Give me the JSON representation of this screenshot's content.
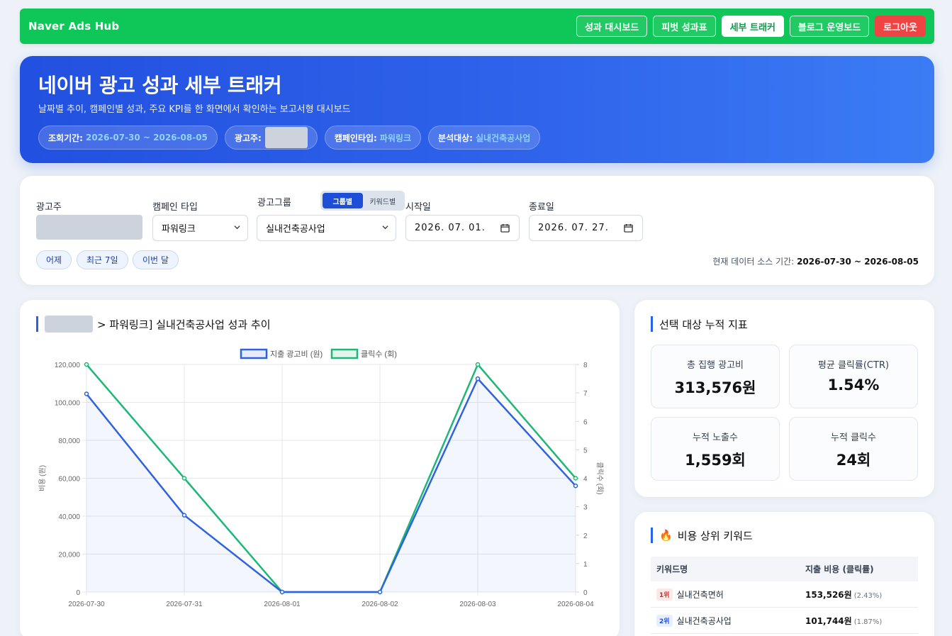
{
  "nav": {
    "brand": "Naver Ads Hub",
    "items": [
      {
        "label": "성과 대시보드"
      },
      {
        "label": "피벗 성과표"
      },
      {
        "label": "세부 트래커"
      },
      {
        "label": "블로그 운영보드"
      },
      {
        "label": "로그아웃"
      }
    ],
    "active_index": 2
  },
  "hero": {
    "title": "네이버 광고 성과 세부 트래커",
    "subtitle": "날짜별 추이, 캠페인별 성과, 주요 KPI를 한 화면에서 확인하는 보고서형 대시보드",
    "chips": {
      "period_label": "조회기간:",
      "period_value": "2026-07-30 ~ 2026-08-05",
      "advertiser_label": "광고주:",
      "campaign_type_label": "캠페인타입:",
      "campaign_type_value": "파워링크",
      "target_label": "분석대상:",
      "target_value": "실내건축공사업"
    }
  },
  "filters": {
    "advertiser_label": "광고주",
    "campaign_type_label": "캠페인 타입",
    "campaign_type_value": "파워링크",
    "adgroup_label": "광고그룹",
    "adgroup_value": "실내건축공사업",
    "toggle": [
      "그룹별",
      "키워드별"
    ],
    "start_label": "시작일",
    "start_value": "2026. 07. 01.",
    "end_label": "종료일",
    "end_value": "2026. 07. 27.",
    "quick": [
      "어제",
      "최근 7일",
      "이번 달"
    ],
    "source_label": "현재 데이터 소스 기간:",
    "source_value": "2026-07-30 ~ 2026-08-05"
  },
  "chart": {
    "title": "> 파워링크] 실내건축공사업 성과 추이",
    "colors": {
      "spend": "#2f62e3",
      "clicks": "#1cb877"
    }
  },
  "chart_data": {
    "type": "line",
    "categories": [
      "2026-07-30",
      "2026-07-31",
      "2026-08-01",
      "2026-08-02",
      "2026-08-03",
      "2026-08-04"
    ],
    "series": [
      {
        "name": "지출 광고비 (원)",
        "axis": "left",
        "values": [
          104500,
          40500,
          0,
          0,
          112500,
          56000
        ]
      },
      {
        "name": "클릭수 (회)",
        "axis": "right",
        "values": [
          8,
          4,
          0,
          0,
          8,
          4
        ]
      }
    ],
    "ylabel": "비용 (원)",
    "y2label": "클릭수 (회)",
    "ylim": [
      0,
      120000
    ],
    "y2lim": [
      0,
      8
    ],
    "yticks": [
      "0",
      "20,000",
      "40,000",
      "60,000",
      "80,000",
      "100,000",
      "120,000"
    ],
    "y2ticks": [
      "0",
      "1",
      "2",
      "3",
      "4",
      "5",
      "6",
      "7",
      "8"
    ],
    "grid": true,
    "legend": "top"
  },
  "kpi": {
    "title": "선택 대상 누적 지표",
    "items": [
      {
        "label": "총 집행 광고비",
        "value": "313,576원"
      },
      {
        "label": "평균 클릭률(CTR)",
        "value": "1.54%"
      },
      {
        "label": "누적 노출수",
        "value": "1,559회"
      },
      {
        "label": "누적 클릭수",
        "value": "24회"
      }
    ]
  },
  "keywords": {
    "title": "비용 상위 키워드",
    "icon": "🔥",
    "col_name": "키워드명",
    "col_cost": "지출 비용 (클릭률)",
    "rows": [
      {
        "rank": "1위",
        "name": "실내건축면허",
        "cost": "153,526원",
        "ctr": "(2.43%)"
      },
      {
        "rank": "2위",
        "name": "실내건축공사업",
        "cost": "101,744원",
        "ctr": "(1.87%)"
      }
    ]
  }
}
